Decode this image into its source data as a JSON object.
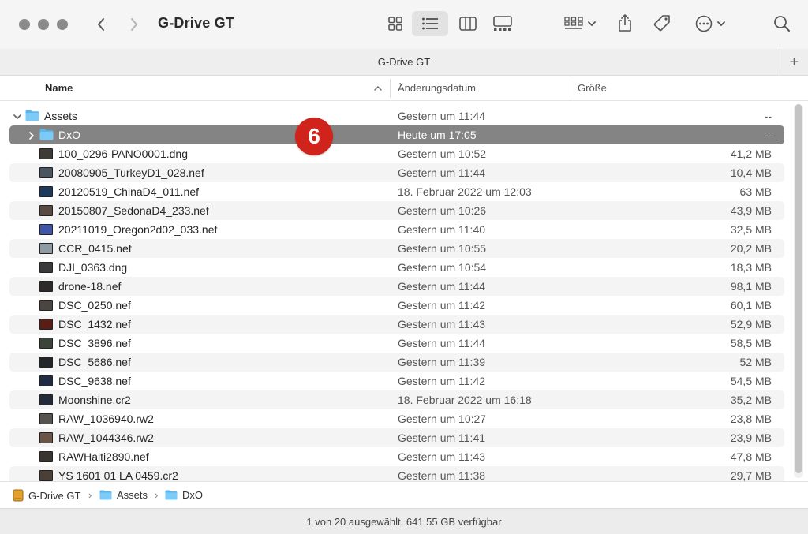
{
  "window": {
    "title": "G-Drive GT"
  },
  "toolbar": {
    "back_icon": "chevron-left-icon",
    "forward_icon": "chevron-right-icon",
    "views": [
      "icon-view-icon",
      "list-view-icon",
      "column-view-icon",
      "gallery-view-icon"
    ],
    "active_view": "list",
    "actions": [
      "group-icon",
      "share-icon",
      "tag-icon",
      "more-icon",
      "search-icon"
    ]
  },
  "tab": {
    "title": "G-Drive GT",
    "add_label": "+"
  },
  "columns": {
    "name": "Name",
    "date": "Änderungsdatum",
    "size": "Größe"
  },
  "rows": [
    {
      "name": "Assets",
      "date": "Gestern um 11:44",
      "size": "--",
      "kind": "folder",
      "indent": 0,
      "expanded": true
    },
    {
      "name": "DxO",
      "date": "Heute um 17:05",
      "size": "--",
      "kind": "folder",
      "indent": 1,
      "expanded": false,
      "selected": true
    },
    {
      "name": "100_0296-PANO0001.dng",
      "date": "Gestern um 10:52",
      "size": "41,2 MB",
      "kind": "image",
      "thumb": "#3e3a36"
    },
    {
      "name": "20080905_TurkeyD1_028.nef",
      "date": "Gestern um 11:44",
      "size": "10,4 MB",
      "kind": "image",
      "thumb": "#4a5560"
    },
    {
      "name": "20120519_ChinaD4_011.nef",
      "date": "18. Februar 2022 um 12:03",
      "size": "63 MB",
      "kind": "image",
      "thumb": "#1d3a5c"
    },
    {
      "name": "20150807_SedonaD4_233.nef",
      "date": "Gestern um 10:26",
      "size": "43,9 MB",
      "kind": "image",
      "thumb": "#5a4a44"
    },
    {
      "name": "20211019_Oregon2d02_033.nef",
      "date": "Gestern um 11:40",
      "size": "32,5 MB",
      "kind": "image",
      "thumb": "#3f56a8"
    },
    {
      "name": "CCR_0415.nef",
      "date": "Gestern um 10:55",
      "size": "20,2 MB",
      "kind": "image",
      "thumb": "#8f9aa3"
    },
    {
      "name": "DJI_0363.dng",
      "date": "Gestern um 10:54",
      "size": "18,3 MB",
      "kind": "image",
      "thumb": "#3a3a3a"
    },
    {
      "name": "drone-18.nef",
      "date": "Gestern um 11:44",
      "size": "98,1 MB",
      "kind": "image",
      "thumb": "#2e2a2a"
    },
    {
      "name": "DSC_0250.nef",
      "date": "Gestern um 11:42",
      "size": "60,1 MB",
      "kind": "image",
      "thumb": "#4b4541"
    },
    {
      "name": "DSC_1432.nef",
      "date": "Gestern um 11:43",
      "size": "52,9 MB",
      "kind": "image",
      "thumb": "#5a1c14"
    },
    {
      "name": "DSC_3896.nef",
      "date": "Gestern um 11:44",
      "size": "58,5 MB",
      "kind": "image",
      "thumb": "#3c443a"
    },
    {
      "name": "DSC_5686.nef",
      "date": "Gestern um 11:39",
      "size": "52 MB",
      "kind": "image",
      "thumb": "#22262a"
    },
    {
      "name": "DSC_9638.nef",
      "date": "Gestern um 11:42",
      "size": "54,5 MB",
      "kind": "image",
      "thumb": "#1f2c44"
    },
    {
      "name": "Moonshine.cr2",
      "date": "18. Februar 2022 um 16:18",
      "size": "35,2 MB",
      "kind": "image",
      "thumb": "#222a3c"
    },
    {
      "name": "RAW_1036940.rw2",
      "date": "Gestern um 10:27",
      "size": "23,8 MB",
      "kind": "image",
      "thumb": "#57534f"
    },
    {
      "name": "RAW_1044346.rw2",
      "date": "Gestern um 11:41",
      "size": "23,9 MB",
      "kind": "image",
      "thumb": "#6a5546"
    },
    {
      "name": "RAWHaiti2890.nef",
      "date": "Gestern um 11:43",
      "size": "47,8 MB",
      "kind": "image",
      "thumb": "#3a3431"
    },
    {
      "name": "YS 1601 01 LA 0459.cr2",
      "date": "Gestern um 11:38",
      "size": "29,7 MB",
      "kind": "image",
      "thumb": "#4a4038"
    }
  ],
  "annotation_badge": "6",
  "path": [
    {
      "label": "G-Drive GT",
      "icon": "drive-icon"
    },
    {
      "label": "Assets",
      "icon": "folder-icon"
    },
    {
      "label": "DxO",
      "icon": "folder-icon"
    }
  ],
  "path_separator": "›",
  "status": "1 von 20 ausgewählt, 641,55 GB verfügbar",
  "colors": {
    "selection": "#848484",
    "badge": "#d0231c",
    "folder": "#59b7f0",
    "drive": "#e3a02b"
  }
}
